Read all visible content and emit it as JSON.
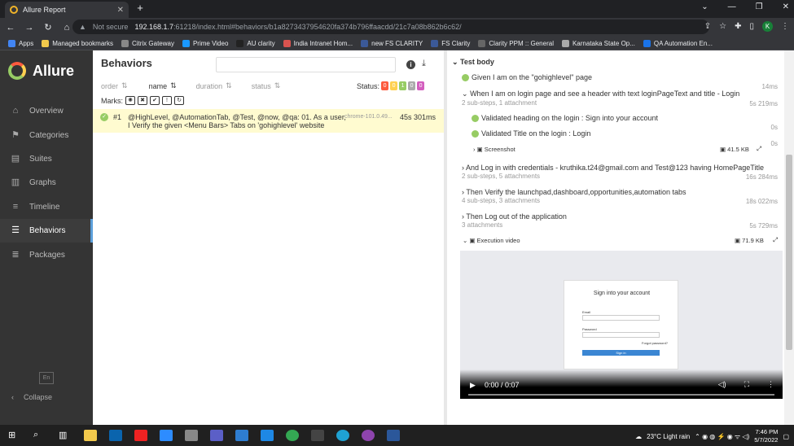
{
  "browser": {
    "tab_title": "Allure Report",
    "not_secure": "Not secure",
    "url_host": "192.168.1.7",
    "url_rest": ":61218/index.html#behaviors/b1a8273437954620fa374b796ffaacdd/21c7a08b862b6c62/",
    "profile_initial": "K"
  },
  "bookmarks": [
    "Apps",
    "Managed bookmarks",
    "Citrix Gateway",
    "Prime Video",
    "AU clarity",
    "India Intranet Hom...",
    "new FS CLARITY",
    "FS Clarity",
    "Clarity PPM :: General",
    "Karnataka State Op...",
    "QA Automation En..."
  ],
  "sidebar": {
    "brand": "Allure",
    "items": [
      {
        "label": "Overview",
        "icon": "home-icon"
      },
      {
        "label": "Categories",
        "icon": "flag-icon"
      },
      {
        "label": "Suites",
        "icon": "briefcase-icon"
      },
      {
        "label": "Graphs",
        "icon": "bar-chart-icon"
      },
      {
        "label": "Timeline",
        "icon": "timeline-icon"
      },
      {
        "label": "Behaviors",
        "icon": "list-icon"
      },
      {
        "label": "Packages",
        "icon": "layers-icon"
      }
    ],
    "lang": "En",
    "collapse": "Collapse"
  },
  "behaviors": {
    "title": "Behaviors",
    "sort": {
      "order": "order",
      "name": "name",
      "duration": "duration",
      "status": "status"
    },
    "status_label": "Status:",
    "status_counts": [
      {
        "value": "0",
        "color": "#fd5a3e"
      },
      {
        "value": "0",
        "color": "#ffd050"
      },
      {
        "value": "1",
        "color": "#97cc64"
      },
      {
        "value": "0",
        "color": "#aaaaaa"
      },
      {
        "value": "0",
        "color": "#d35ebe"
      }
    ],
    "marks_label": "Marks:",
    "result": {
      "num": "#1",
      "name": "@HighLevel, @AutomationTab, @Test, @now, @qa: 01. As a user, I Verify the given <Menu Bars> Tabs on 'gohighlevel' website",
      "env": "chrome-101.0.49...",
      "duration": "45s 301ms"
    }
  },
  "test_body": {
    "header": "Test body",
    "steps": [
      {
        "title": "Given I am on the \"gohighlevel\" page",
        "sub": "",
        "dur": "14ms"
      },
      {
        "title": "When I am on login page and see a header with text loginPageText and title - Login",
        "sub": "2 sub-steps, 1 attachment",
        "dur": "5s 219ms"
      },
      {
        "title": "Validated heading on the login : Sign into your account",
        "sub": "",
        "dur": "0s"
      },
      {
        "title": "Validated Title on the login : Login",
        "sub": "",
        "dur": "0s"
      },
      {
        "title": "And Log in with credentials - kruthika.t24@gmail.com and Test@123 having HomePageTitle",
        "sub": "2 sub-steps, 5 attachments",
        "dur": "16s 284ms"
      },
      {
        "title": "Then Verify the launchpad,dashboard,opportunities,automation tabs",
        "sub": "4 sub-steps, 3 attachments",
        "dur": "18s 022ms"
      },
      {
        "title": "Then Log out of the application",
        "sub": "3 attachments",
        "dur": "5s 729ms"
      }
    ],
    "screenshot": {
      "label": "Screenshot",
      "size": "41.5 KB"
    },
    "video": {
      "label": "Execution video",
      "size": "71.9 KB",
      "time": "0:00 / 0:07"
    },
    "signin": {
      "title": "Sign into your account",
      "email": "Email",
      "password": "Password",
      "forgot": "Forgot password?",
      "button": "Sign in"
    }
  },
  "taskbar": {
    "weather": "23°C  Light rain",
    "time": "7:46 PM",
    "date": "5/7/2022"
  }
}
